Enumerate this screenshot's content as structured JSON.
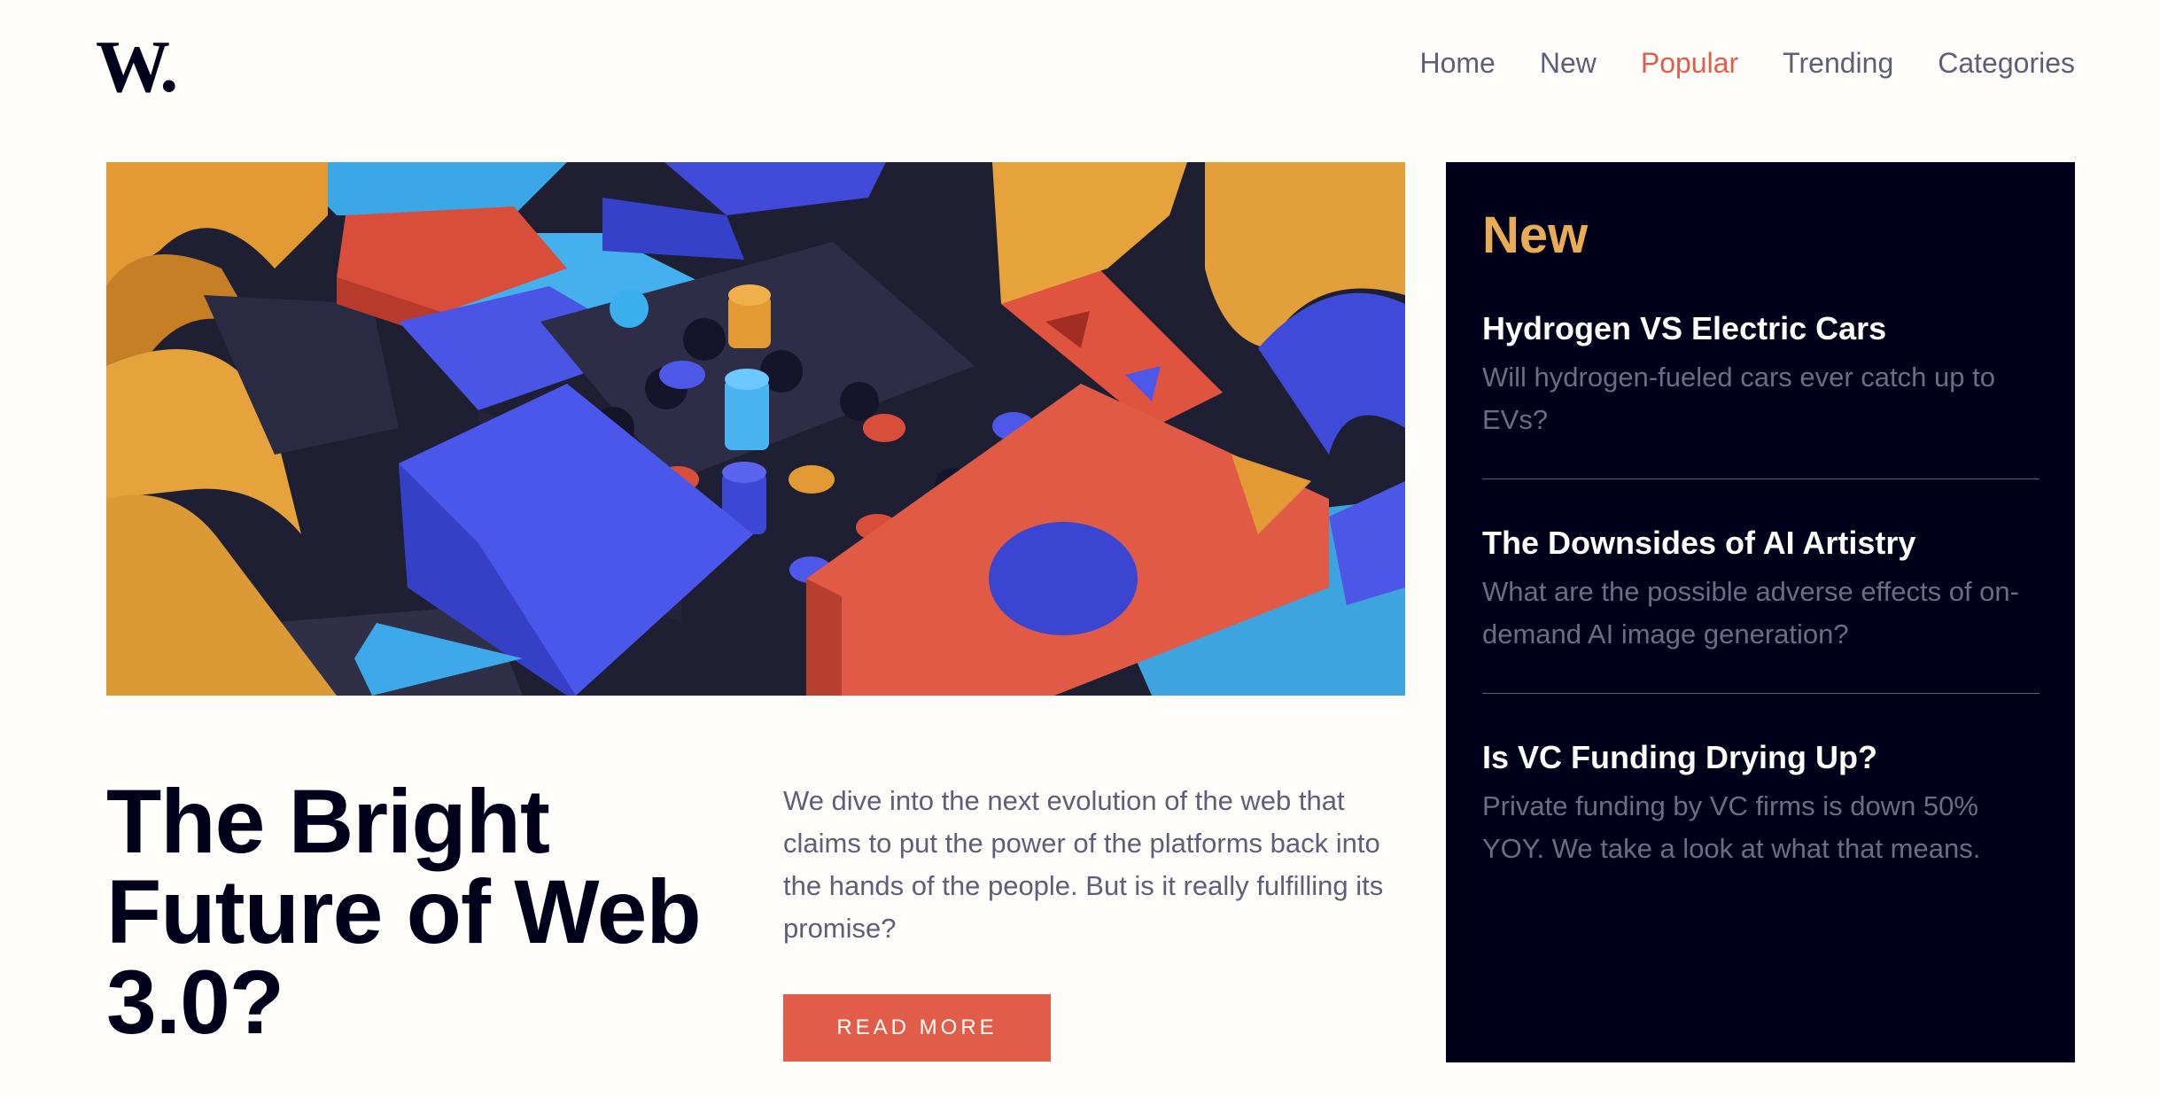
{
  "brand": {
    "logo": "W."
  },
  "nav": {
    "items": [
      "Home",
      "New",
      "Popular",
      "Trending",
      "Categories"
    ],
    "active": "Popular",
    "accent_color": "#e15d49"
  },
  "hero": {
    "image_label": "Abstract 3D wooden blocks illustration",
    "headline": "The Bright Future of Web 3.0?",
    "intro": "We dive into the next evolution of the web that claims to put the power of the platforms back into the hands of the people. But is it really fulfilling its promise?",
    "cta_label": "READ MORE"
  },
  "sidebar": {
    "title": "New",
    "items": [
      {
        "title": "Hydrogen VS Electric Cars",
        "summary": "Will hydrogen-fueled cars ever catch up to EVs?"
      },
      {
        "title": "The Downsides of AI Artistry",
        "summary": "What are the possible adverse effects of on-demand AI image generation?"
      },
      {
        "title": "Is VC Funding Drying Up?",
        "summary": "Private funding by VC firms is down 50% YOY. We take a look at what that means."
      }
    ]
  },
  "colors": {
    "background": "#fffdf9",
    "dark": "#00001a",
    "accent_red": "#e15d49",
    "accent_gold": "#e9ab53",
    "text_muted": "#5d5f79"
  }
}
